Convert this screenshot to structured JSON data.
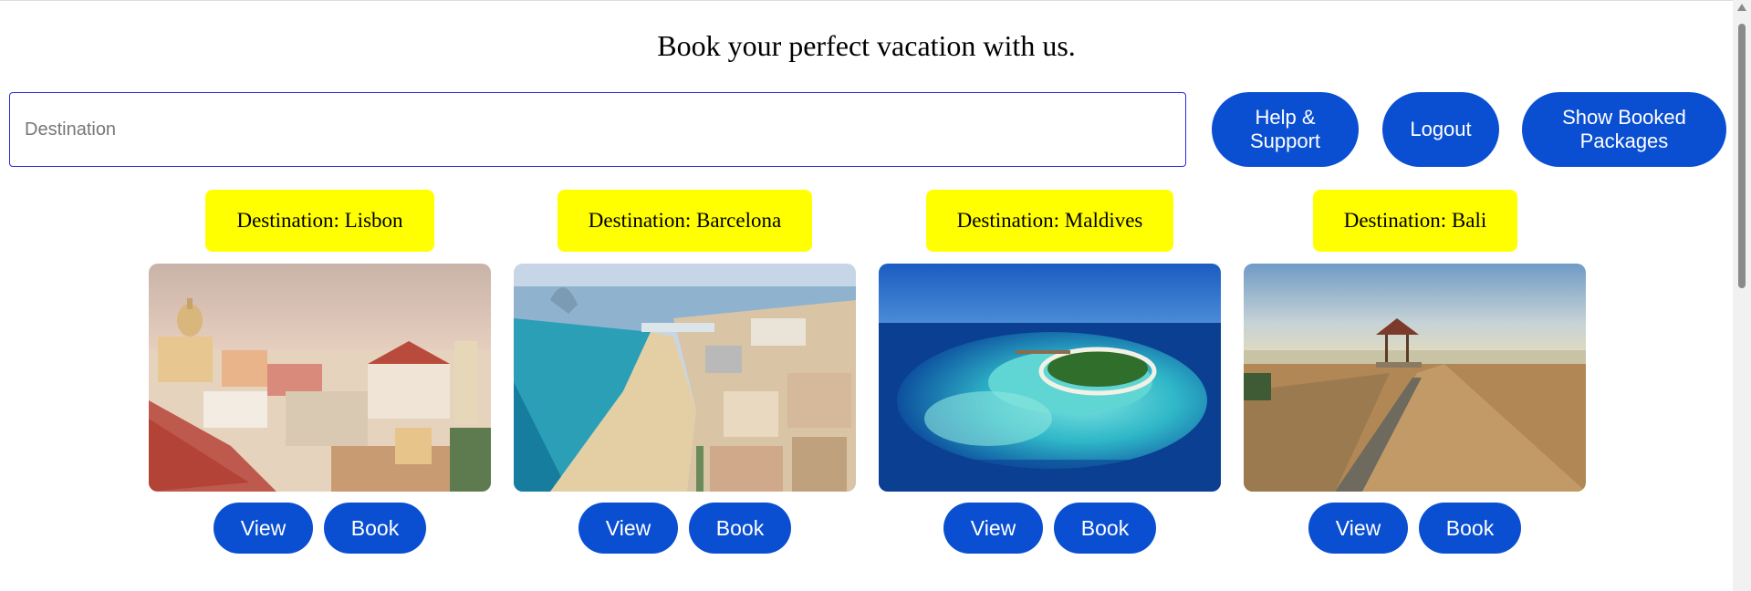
{
  "header": {
    "title": "Book your perfect vacation with us."
  },
  "search": {
    "placeholder": "Destination",
    "value": ""
  },
  "actions": {
    "help_line1": "Help &",
    "help_line2": "Support",
    "logout": "Logout",
    "booked_line1": "Show Booked",
    "booked_line2": "Packages"
  },
  "packages": [
    {
      "label": "Destination: Lisbon",
      "view": "View",
      "book": "Book"
    },
    {
      "label": "Destination: Barcelona",
      "view": "View",
      "book": "Book"
    },
    {
      "label": "Destination: Maldives",
      "view": "View",
      "book": "Book"
    },
    {
      "label": "Destination: Bali",
      "view": "View",
      "book": "Book"
    }
  ],
  "colors": {
    "accent": "#0a4fd1",
    "label_background": "#ffff00",
    "input_border": "#2b2bd6"
  },
  "icons": {
    "scroll_up": "triangle-up-icon"
  }
}
